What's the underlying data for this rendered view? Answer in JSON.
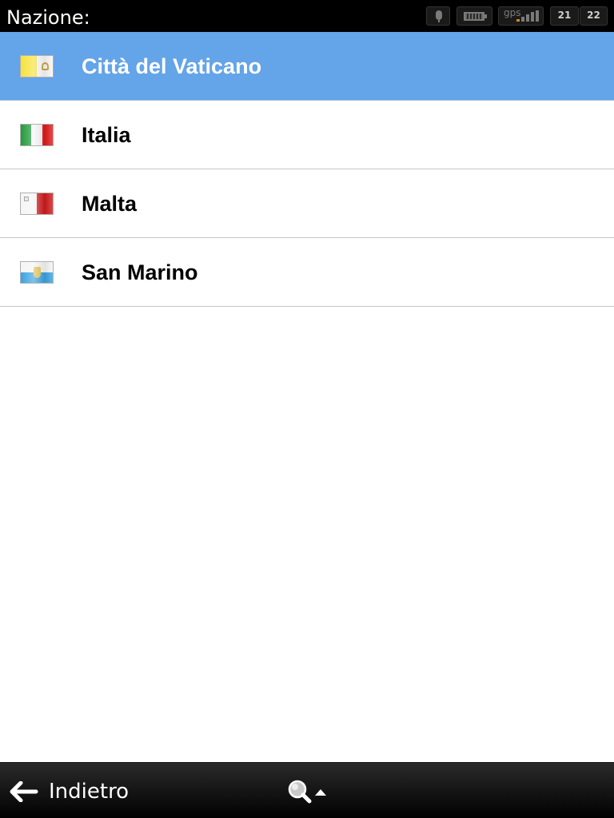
{
  "header": {
    "title": "Nazione:"
  },
  "status": {
    "mic_icon": "microphone-icon",
    "battery_icon": "battery-icon",
    "gps_label": "gps",
    "hours": [
      "21",
      "22"
    ]
  },
  "countries": [
    {
      "name": "Città del Vaticano",
      "flag": "vatican-flag-icon",
      "selected": true
    },
    {
      "name": "Italia",
      "flag": "italy-flag-icon",
      "selected": false
    },
    {
      "name": "Malta",
      "flag": "malta-flag-icon",
      "selected": false
    },
    {
      "name": "San Marino",
      "flag": "san-marino-flag-icon",
      "selected": false
    }
  ],
  "footer": {
    "back_label": "Indietro",
    "back_icon": "back-arrow-icon",
    "search_icon": "search-icon"
  },
  "colors": {
    "selected_row": "#64a4e8",
    "bar_background": "#000000"
  }
}
